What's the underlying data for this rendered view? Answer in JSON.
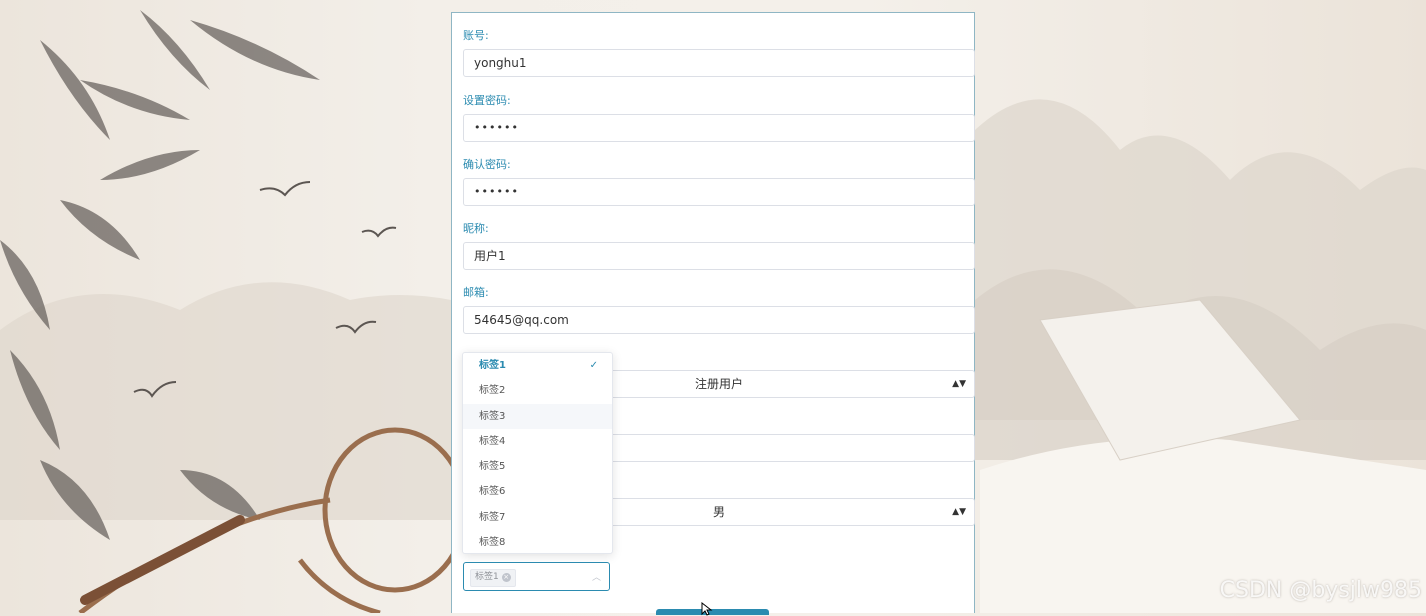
{
  "form": {
    "account_label": "账号:",
    "account_value": "yonghu1",
    "password_label": "设置密码:",
    "password_value": "••••••",
    "confirm_label": "确认密码:",
    "confirm_value": "••••••",
    "nickname_label": "昵称:",
    "nickname_value": "用户1",
    "email_label": "邮箱:",
    "email_value": "54645@qq.com",
    "identity_select_value": "注册用户",
    "gender_select_value": "男"
  },
  "tag_dropdown": {
    "options": [
      "标签1",
      "标签2",
      "标签3",
      "标签4",
      "标签5",
      "标签6",
      "标签7",
      "标签8"
    ],
    "selected": "标签1",
    "hovered": "标签3",
    "selected_chip": "标签1"
  },
  "watermark": "CSDN @bysjlw985",
  "colors": {
    "accent": "#2b8bb0",
    "border": "#dcdfe6"
  }
}
